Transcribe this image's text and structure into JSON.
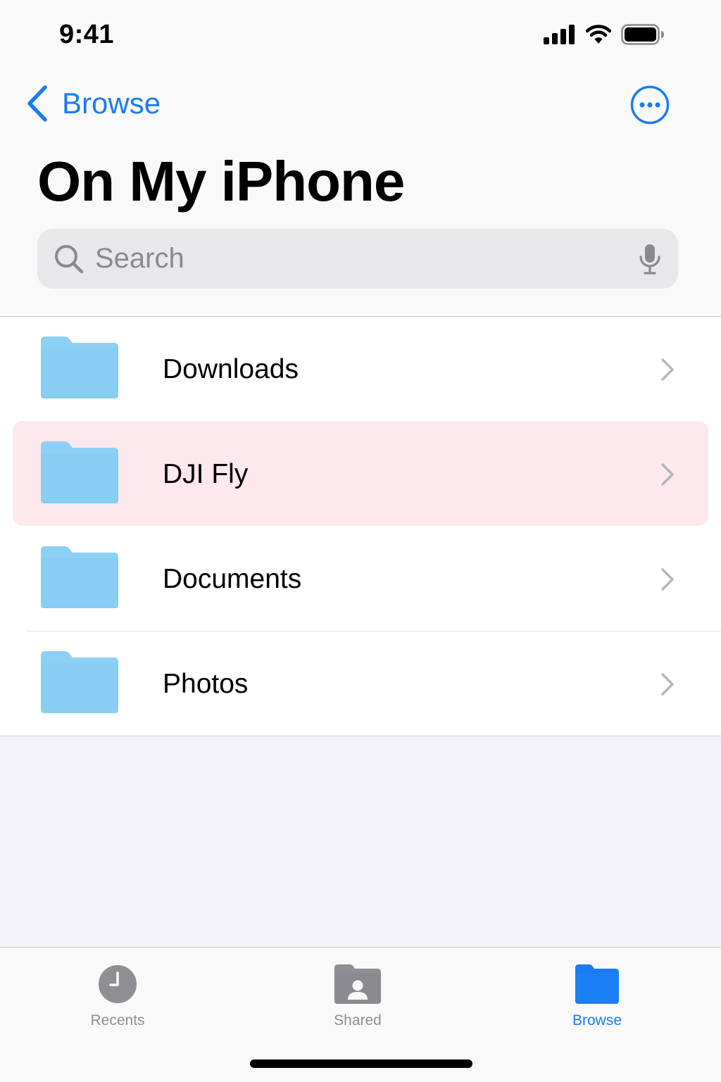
{
  "status_bar": {
    "time": "9:41",
    "icons": [
      "cellular-signal-icon",
      "wifi-icon",
      "battery-icon"
    ]
  },
  "nav": {
    "back_label": "Browse",
    "back_icon": "chevron-left-icon",
    "more_icon": "ellipsis-circle-icon"
  },
  "title": "On My iPhone",
  "search": {
    "placeholder": "Search",
    "search_icon": "magnifying-glass-icon",
    "mic_icon": "microphone-icon"
  },
  "folders": [
    {
      "name": "Downloads",
      "icon": "folder-icon",
      "highlighted": false
    },
    {
      "name": "DJI Fly",
      "icon": "folder-icon",
      "highlighted": true
    },
    {
      "name": "Documents",
      "icon": "folder-icon",
      "highlighted": false
    },
    {
      "name": "Photos",
      "icon": "folder-icon",
      "highlighted": false
    }
  ],
  "tab_bar": {
    "tabs": [
      {
        "label": "Recents",
        "icon": "clock-icon",
        "active": false
      },
      {
        "label": "Shared",
        "icon": "shared-folder-icon",
        "active": false
      },
      {
        "label": "Browse",
        "icon": "folder-icon",
        "active": true
      }
    ]
  },
  "colors": {
    "accent": "#1a7cf0",
    "folder": "#8dd0f5",
    "highlight": "#fde8ee",
    "inactive": "#8e8e93"
  }
}
